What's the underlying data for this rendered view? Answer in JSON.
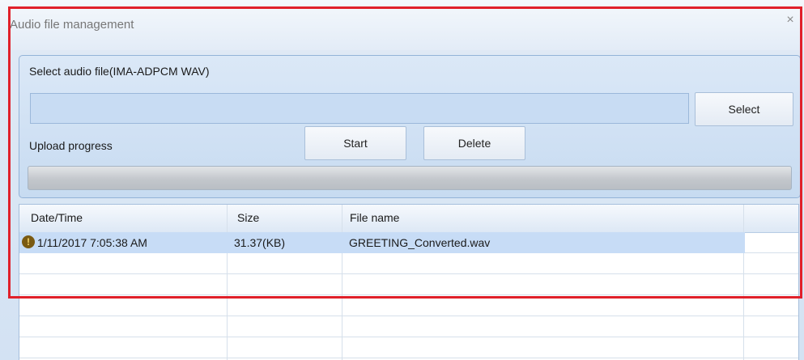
{
  "window": {
    "title": "Audio file management",
    "close_glyph": "×"
  },
  "panel": {
    "select_label": "Select audio file(IMA-ADPCM WAV)",
    "file_path_value": "",
    "select_button": "Select",
    "upload_progress_label": "Upload progress",
    "start_button": "Start",
    "delete_button": "Delete",
    "upload_progress_fraction": 0
  },
  "table": {
    "columns": [
      "Date/Time",
      "Size",
      "File name"
    ],
    "rows": [
      {
        "icon": "warning-icon",
        "icon_glyph": "!",
        "datetime": "1/11/2017 7:05:38 AM",
        "size": "31.37(KB)",
        "filename": "GREETING_Converted.wav"
      }
    ]
  },
  "colors": {
    "highlight_border": "#e0202a",
    "selected_row": "#c7dcf6",
    "window_bg": "#dce8f5"
  }
}
